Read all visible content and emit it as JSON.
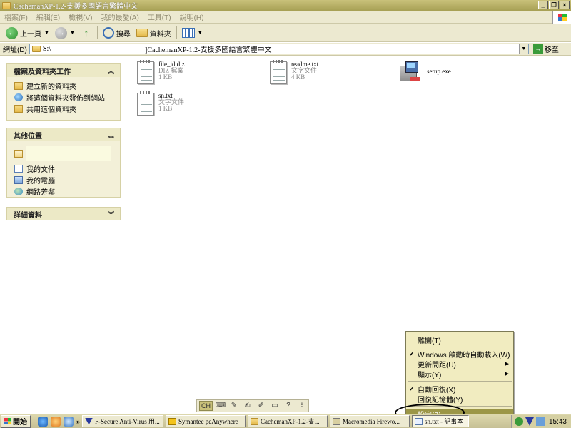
{
  "window": {
    "title": "CachemanXP-1.2-支援多國語言繁體中文",
    "controls": {
      "minimize": "_",
      "restore": "❐",
      "close": "×"
    }
  },
  "menubar": {
    "items": [
      "檔案(F)",
      "編輯(E)",
      "檢視(V)",
      "我的最愛(A)",
      "工具(T)",
      "說明(H)"
    ]
  },
  "toolbar": {
    "back_label": "上一頁",
    "search_label": "搜尋",
    "folders_label": "資料夾"
  },
  "address": {
    "label": "網址(D)",
    "prefix": "S:\\",
    "path": "]CachemanXP-1.2-支援多國語言繁體中文",
    "go_label": "移至"
  },
  "taskpane": {
    "file_tasks": {
      "title": "檔案及資料夾工作",
      "items": [
        "建立新的資料夾",
        "將這個資料夾發佈到網站",
        "共用這個資料夾"
      ]
    },
    "other_places": {
      "title": "其他位置",
      "items": [
        "我的文件",
        "我的電腦",
        "網路芳鄰"
      ]
    },
    "details": {
      "title": "詳細資料"
    }
  },
  "files": [
    {
      "name": "file_id.diz",
      "type": "DIZ 檔案",
      "size": "1 KB"
    },
    {
      "name": "readme.txt",
      "type": "文字文件",
      "size": "4 KB"
    },
    {
      "name": "setup.exe",
      "type": "",
      "size": ""
    },
    {
      "name": "sn.txt",
      "type": "文字文件",
      "size": "1 KB"
    }
  ],
  "langbar": {
    "lang": "CH"
  },
  "context_menu": {
    "items": [
      {
        "label": "離開(T)"
      },
      {
        "label": "Windows 啟動時自動載入(W)",
        "checked": true
      },
      {
        "label": "更新間距(U)",
        "submenu": true
      },
      {
        "label": "顯示(Y)",
        "submenu": true
      },
      {
        "label": "自動回復(X)",
        "checked": true
      },
      {
        "label": "回復記憶體(Y)"
      },
      {
        "label": "設定(Z)",
        "selected": true
      }
    ]
  },
  "taskbar": {
    "start_label": "開始",
    "more": "»",
    "tasks": [
      "F-Secure Anti-Virus 用...",
      "Symantec pcAnywhere",
      "CachemanXP-1.2-支...",
      "Macromedia Firewo...",
      "sn.txt - 記事本"
    ],
    "clock": "15:43"
  },
  "colors": {
    "title_bar": "#a7a054",
    "panel_bg": "#f3f0d8",
    "menu_selected": "#9b9647",
    "taskbar": "#c6c095"
  }
}
